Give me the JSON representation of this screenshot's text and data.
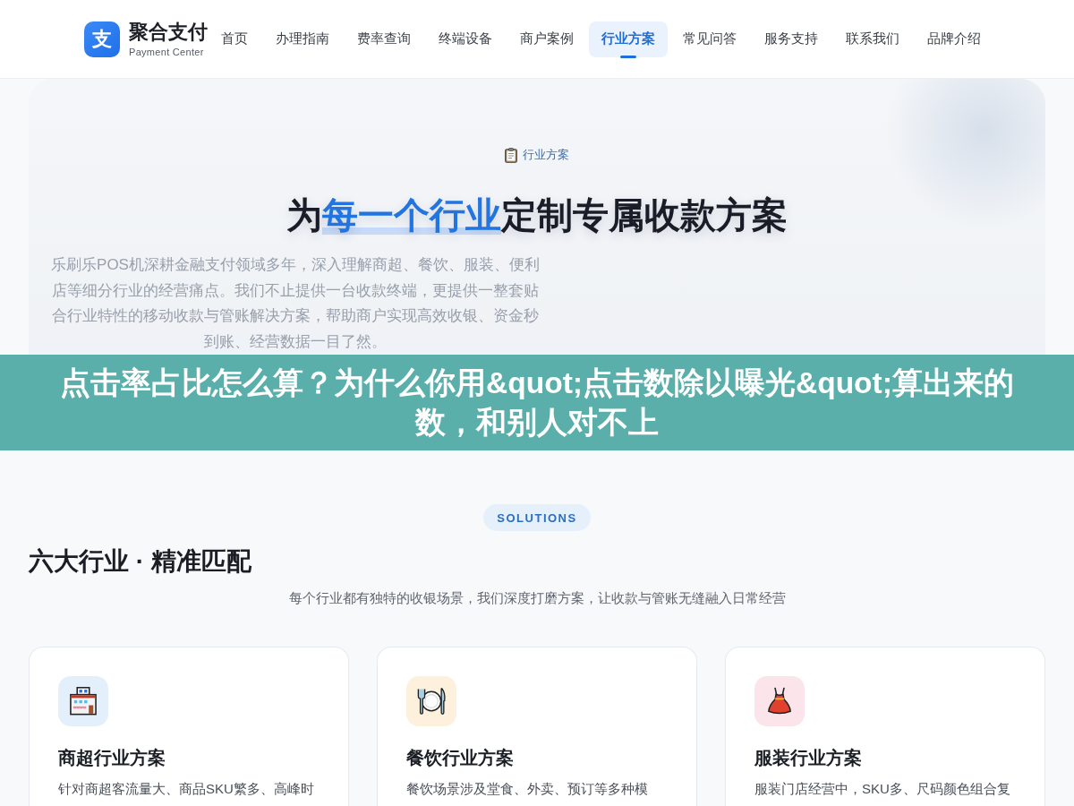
{
  "header": {
    "logo": {
      "mark": "支",
      "name": "聚合支付",
      "subtitle": "Payment Center"
    },
    "nav": [
      {
        "label": "首页",
        "selected": false
      },
      {
        "label": "办理指南",
        "selected": false
      },
      {
        "label": "费率查询",
        "selected": false
      },
      {
        "label": "终端设备",
        "selected": false
      },
      {
        "label": "商户案例",
        "selected": false
      },
      {
        "label": "行业方案",
        "selected": true
      },
      {
        "label": "常见问答",
        "selected": false
      },
      {
        "label": "服务支持",
        "selected": false
      },
      {
        "label": "联系我们",
        "selected": false
      },
      {
        "label": "品牌介绍",
        "selected": false
      }
    ]
  },
  "hero": {
    "badge": "行业方案",
    "title": [
      {
        "text": "为",
        "highlight": false
      },
      {
        "text": "每一个行业",
        "highlight": true
      },
      {
        "text": "定制专属收款方案",
        "highlight": false
      }
    ],
    "description": "乐刷乐POS机深耕金融支付领域多年，深入理解商超、餐饮、服装、便利店等细分行业的经营痛点。我们不止提供一台收款终端，更提供一整套贴合行业特性的移动收款与管账解决方案，帮助商户实现高效收银、资金秒到账、经营数据一目了然。"
  },
  "overlay_title": "点击率占比怎么算？为什么你用&quot;点击数除以曝光&quot;算出来的数，和别人对不上",
  "solutions": {
    "tag": "SOLUTIONS",
    "heading": "六大行业 · 精准匹配",
    "subtitle": "每个行业都有独特的收银场景，我们深度打磨方案，让收款与管账无缝融入日常经营",
    "cards": [
      {
        "kind": "store",
        "title": "商超行业方案",
        "description": "针对商超客流量大、商品SKU繁多、高峰时"
      },
      {
        "kind": "restaurant",
        "title": "餐饮行业方案",
        "description": "餐饮场景涉及堂食、外卖、预订等多种模"
      },
      {
        "kind": "clothing",
        "title": "服装行业方案",
        "description": "服装门店经营中，SKU多、尺码颜色组合复"
      }
    ]
  }
}
